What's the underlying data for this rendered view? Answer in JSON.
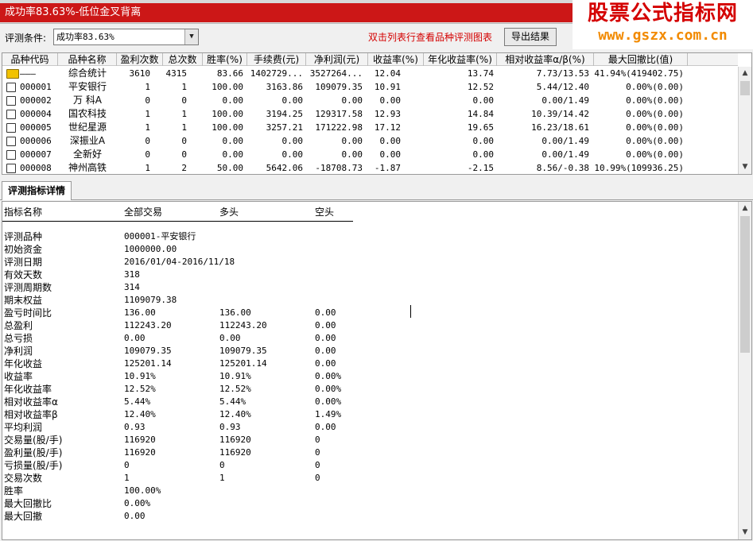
{
  "window": {
    "title": "成功率83.63%-低位金叉背离"
  },
  "watermark": {
    "line1": "股票公式指标网",
    "line2": "www.gszx.com.cn"
  },
  "toolbar": {
    "condition_label": "评测条件:",
    "condition_value": "成功率83.63%",
    "hint": "双击列表行查看品种评测图表",
    "export_label": "导出结果"
  },
  "grid": {
    "columns": [
      "品种代码",
      "品种名称",
      "盈利次数",
      "总次数",
      "胜率(%)",
      "手续费(元)",
      "净利润(元)",
      "收益率(%)",
      "年化收益率(%)",
      "相对收益率α/β(%)",
      "最大回撤比(值)"
    ],
    "rows": [
      {
        "code": "———",
        "name": "综合统计",
        "wins": "3610",
        "total": "4315",
        "rate": "83.66",
        "fee": "1402729...",
        "profit": "3527264...",
        "ret": "12.04",
        "annual": "13.74",
        "relative": "7.73/13.53",
        "drawdown": "41.94%(419402.75)",
        "summary": true
      },
      {
        "code": "000001",
        "name": "平安银行",
        "wins": "1",
        "total": "1",
        "rate": "100.00",
        "fee": "3163.86",
        "profit": "109079.35",
        "ret": "10.91",
        "annual": "12.52",
        "relative": "5.44/12.40",
        "drawdown": "0.00%(0.00)"
      },
      {
        "code": "000002",
        "name": "万 科A",
        "wins": "0",
        "total": "0",
        "rate": "0.00",
        "fee": "0.00",
        "profit": "0.00",
        "ret": "0.00",
        "annual": "0.00",
        "relative": "0.00/1.49",
        "drawdown": "0.00%(0.00)"
      },
      {
        "code": "000004",
        "name": "国农科技",
        "wins": "1",
        "total": "1",
        "rate": "100.00",
        "fee": "3194.25",
        "profit": "129317.58",
        "ret": "12.93",
        "annual": "14.84",
        "relative": "10.39/14.42",
        "drawdown": "0.00%(0.00)"
      },
      {
        "code": "000005",
        "name": "世纪星源",
        "wins": "1",
        "total": "1",
        "rate": "100.00",
        "fee": "3257.21",
        "profit": "171222.98",
        "ret": "17.12",
        "annual": "19.65",
        "relative": "16.23/18.61",
        "drawdown": "0.00%(0.00)"
      },
      {
        "code": "000006",
        "name": "深振业A",
        "wins": "0",
        "total": "0",
        "rate": "0.00",
        "fee": "0.00",
        "profit": "0.00",
        "ret": "0.00",
        "annual": "0.00",
        "relative": "0.00/1.49",
        "drawdown": "0.00%(0.00)"
      },
      {
        "code": "000007",
        "name": "全新好",
        "wins": "0",
        "total": "0",
        "rate": "0.00",
        "fee": "0.00",
        "profit": "0.00",
        "ret": "0.00",
        "annual": "0.00",
        "relative": "0.00/1.49",
        "drawdown": "0.00%(0.00)"
      },
      {
        "code": "000008",
        "name": "神州高铁",
        "wins": "1",
        "total": "2",
        "rate": "50.00",
        "fee": "5642.06",
        "profit": "-18708.73",
        "ret": "-1.87",
        "annual": "-2.15",
        "relative": "8.56/-0.38",
        "drawdown": "10.99%(109936.25)"
      }
    ]
  },
  "tab": {
    "label": "评测指标详情"
  },
  "detail": {
    "headers": [
      "指标名称",
      "全部交易",
      "多头",
      "空头"
    ],
    "rows": [
      {
        "k": "评测品种",
        "a": "000001-平安银行",
        "b": "",
        "c": ""
      },
      {
        "k": "初始资金",
        "a": "1000000.00",
        "b": "",
        "c": ""
      },
      {
        "k": "评测日期",
        "a": "2016/01/04-2016/11/18",
        "b": "",
        "c": ""
      },
      {
        "k": "有效天数",
        "a": "318",
        "b": "",
        "c": ""
      },
      {
        "k": "评测周期数",
        "a": "314",
        "b": "",
        "c": ""
      },
      {
        "k": "期末权益",
        "a": "1109079.38",
        "b": "",
        "c": ""
      },
      {
        "k": "盈亏时间比",
        "a": "136.00",
        "b": "136.00",
        "c": "0.00"
      },
      {
        "k": "总盈利",
        "a": "112243.20",
        "b": "112243.20",
        "c": "0.00"
      },
      {
        "k": "总亏损",
        "a": "0.00",
        "b": "0.00",
        "c": "0.00"
      },
      {
        "k": "净利润",
        "a": "109079.35",
        "b": "109079.35",
        "c": "0.00"
      },
      {
        "k": "年化收益",
        "a": "125201.14",
        "b": "125201.14",
        "c": "0.00"
      },
      {
        "k": "收益率",
        "a": "10.91%",
        "b": "10.91%",
        "c": "0.00%"
      },
      {
        "k": "年化收益率",
        "a": "12.52%",
        "b": "12.52%",
        "c": "0.00%"
      },
      {
        "k": "相对收益率α",
        "a": "5.44%",
        "b": "5.44%",
        "c": "0.00%"
      },
      {
        "k": "相对收益率β",
        "a": "12.40%",
        "b": "12.40%",
        "c": "1.49%"
      },
      {
        "k": "平均利润",
        "a": "0.93",
        "b": "0.93",
        "c": "0.00"
      },
      {
        "k": "交易量(股/手)",
        "a": "116920",
        "b": "116920",
        "c": "0"
      },
      {
        "k": "盈利量(股/手)",
        "a": "116920",
        "b": "116920",
        "c": "0"
      },
      {
        "k": "亏损量(股/手)",
        "a": "0",
        "b": "0",
        "c": "0"
      },
      {
        "k": "交易次数",
        "a": "1",
        "b": "1",
        "c": "0"
      },
      {
        "k": "胜率",
        "a": "100.00%",
        "b": "",
        "c": ""
      },
      {
        "k": "最大回撤比",
        "a": "0.00%",
        "b": "",
        "c": ""
      },
      {
        "k": "最大回撤",
        "a": "0.00",
        "b": "",
        "c": ""
      }
    ]
  }
}
